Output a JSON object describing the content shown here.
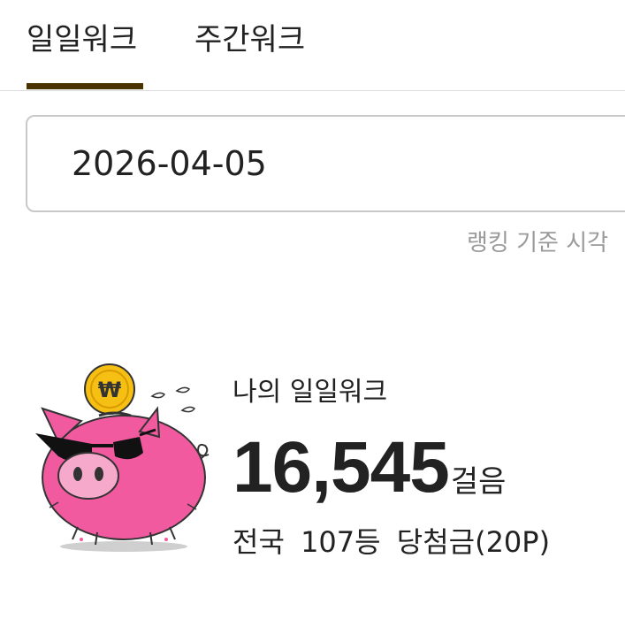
{
  "tabs": [
    {
      "label": "일일워크",
      "selected": true
    },
    {
      "label": "주간워크",
      "selected": false
    }
  ],
  "accent_color": "#4a3300",
  "date_picker": {
    "value": "2026-04-05"
  },
  "ranking_note": "랭킹 기준 시각",
  "my_walk": {
    "title": "나의 일일워크",
    "steps": "16,545",
    "steps_unit": "걸음",
    "nationwide": "전국",
    "rank": "107등",
    "prize": "당첨금(20P)"
  },
  "mascot": {
    "icon": "pink-pig-piggy-bank-icon",
    "coin_symbol": "₩",
    "pig_color": "#f25aa0",
    "coin_color": "#f5c013"
  }
}
